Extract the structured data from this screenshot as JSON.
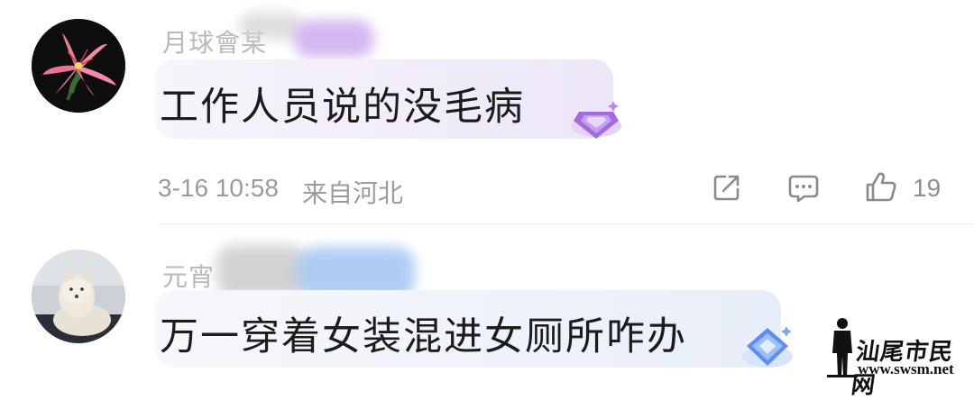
{
  "comments": [
    {
      "username": "月球會某",
      "text": "工作人员说的没毛病",
      "time": "3-16 10:58",
      "location": "来自河北",
      "likes": "19",
      "avatar_icon": "lily-flower-avatar",
      "badge_icon": "purple-gem-badge"
    },
    {
      "username": "元宵",
      "text": "万一穿着女装混进女厕所咋办",
      "avatar_icon": "white-fox-avatar",
      "badge_icon": "blue-gem-badge"
    }
  ],
  "watermark": {
    "site_name": "汕尾市民网",
    "url": "www.swsm.net"
  },
  "colors": {
    "purple_badge": "#a46be0",
    "blue_badge": "#5e8ef0",
    "meta_text": "#9b9b9b"
  }
}
